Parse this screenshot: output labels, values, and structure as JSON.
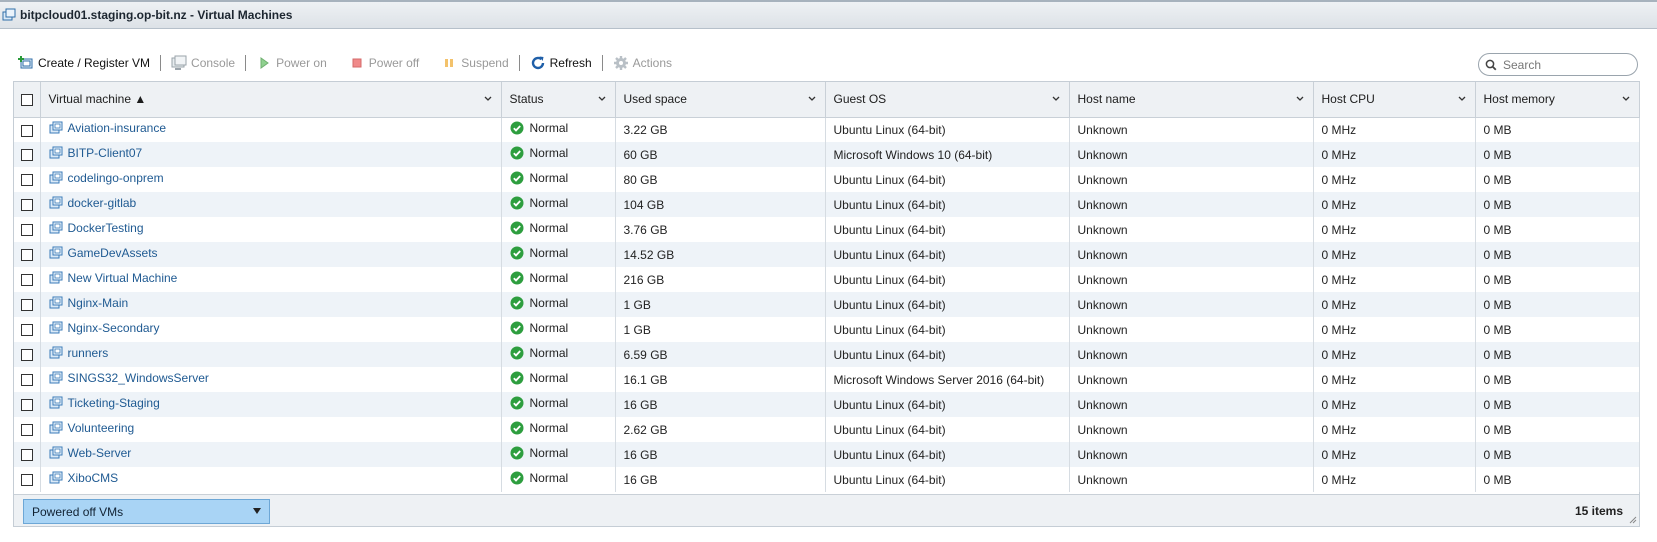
{
  "window": {
    "title": "bitpcloud01.staging.op-bit.nz - Virtual Machines"
  },
  "toolbar": {
    "create": "Create / Register VM",
    "console": "Console",
    "power_on": "Power on",
    "power_off": "Power off",
    "suspend": "Suspend",
    "refresh": "Refresh",
    "actions": "Actions"
  },
  "search": {
    "placeholder": "Search"
  },
  "table": {
    "columns": [
      "Virtual machine ▲",
      "Status",
      "Used space",
      "Guest OS",
      "Host name",
      "Host CPU",
      "Host memory"
    ],
    "rows": [
      {
        "name": "Aviation-insurance",
        "status": "Normal",
        "used": "3.22 GB",
        "os": "Ubuntu Linux (64-bit)",
        "host": "Unknown",
        "cpu": "0 MHz",
        "mem": "0 MB"
      },
      {
        "name": "BITP-Client07",
        "status": "Normal",
        "used": "60 GB",
        "os": "Microsoft Windows 10 (64-bit)",
        "host": "Unknown",
        "cpu": "0 MHz",
        "mem": "0 MB"
      },
      {
        "name": "codelingo-onprem",
        "status": "Normal",
        "used": "80 GB",
        "os": "Ubuntu Linux (64-bit)",
        "host": "Unknown",
        "cpu": "0 MHz",
        "mem": "0 MB"
      },
      {
        "name": "docker-gitlab",
        "status": "Normal",
        "used": "104 GB",
        "os": "Ubuntu Linux (64-bit)",
        "host": "Unknown",
        "cpu": "0 MHz",
        "mem": "0 MB"
      },
      {
        "name": "DockerTesting",
        "status": "Normal",
        "used": "3.76 GB",
        "os": "Ubuntu Linux (64-bit)",
        "host": "Unknown",
        "cpu": "0 MHz",
        "mem": "0 MB"
      },
      {
        "name": "GameDevAssets",
        "status": "Normal",
        "used": "14.52 GB",
        "os": "Ubuntu Linux (64-bit)",
        "host": "Unknown",
        "cpu": "0 MHz",
        "mem": "0 MB"
      },
      {
        "name": "New Virtual Machine",
        "status": "Normal",
        "used": "216 GB",
        "os": "Ubuntu Linux (64-bit)",
        "host": "Unknown",
        "cpu": "0 MHz",
        "mem": "0 MB"
      },
      {
        "name": "Nginx-Main",
        "status": "Normal",
        "used": "1 GB",
        "os": "Ubuntu Linux (64-bit)",
        "host": "Unknown",
        "cpu": "0 MHz",
        "mem": "0 MB"
      },
      {
        "name": "Nginx-Secondary",
        "status": "Normal",
        "used": "1 GB",
        "os": "Ubuntu Linux (64-bit)",
        "host": "Unknown",
        "cpu": "0 MHz",
        "mem": "0 MB"
      },
      {
        "name": "runners",
        "status": "Normal",
        "used": "6.59 GB",
        "os": "Ubuntu Linux (64-bit)",
        "host": "Unknown",
        "cpu": "0 MHz",
        "mem": "0 MB"
      },
      {
        "name": "SINGS32_WindowsServer",
        "status": "Normal",
        "used": "16.1 GB",
        "os": "Microsoft Windows Server 2016 (64-bit)",
        "host": "Unknown",
        "cpu": "0 MHz",
        "mem": "0 MB"
      },
      {
        "name": "Ticketing-Staging",
        "status": "Normal",
        "used": "16 GB",
        "os": "Ubuntu Linux (64-bit)",
        "host": "Unknown",
        "cpu": "0 MHz",
        "mem": "0 MB"
      },
      {
        "name": "Volunteering",
        "status": "Normal",
        "used": "2.62 GB",
        "os": "Ubuntu Linux (64-bit)",
        "host": "Unknown",
        "cpu": "0 MHz",
        "mem": "0 MB"
      },
      {
        "name": "Web-Server",
        "status": "Normal",
        "used": "16 GB",
        "os": "Ubuntu Linux (64-bit)",
        "host": "Unknown",
        "cpu": "0 MHz",
        "mem": "0 MB"
      },
      {
        "name": "XiboCMS",
        "status": "Normal",
        "used": "16 GB",
        "os": "Ubuntu Linux (64-bit)",
        "host": "Unknown",
        "cpu": "0 MHz",
        "mem": "0 MB"
      }
    ]
  },
  "footer": {
    "filter": "Powered off VMs",
    "count": "15 items"
  },
  "colors": {
    "link": "#1f5a92",
    "status_ok": "#2e9e3f",
    "filter_bg": "#a9d4f5",
    "row_alt": "#eef3f8"
  }
}
